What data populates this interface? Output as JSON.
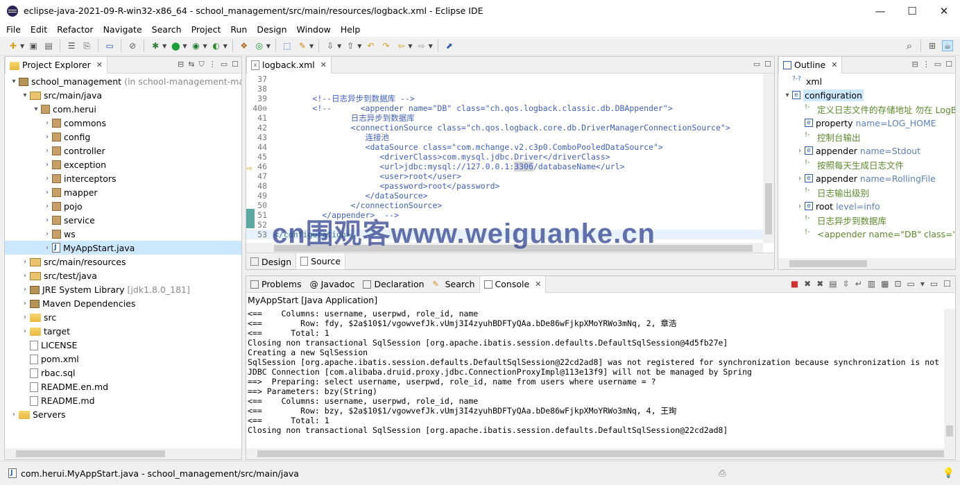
{
  "window": {
    "title": "eclipse-java-2021-09-R-win32-x86_64 - school_management/src/main/resources/logback.xml - Eclipse IDE",
    "minimize": "—",
    "maximize": "☐",
    "close": "✕"
  },
  "menu": [
    "File",
    "Edit",
    "Refactor",
    "Navigate",
    "Search",
    "Project",
    "Run",
    "Design",
    "Window",
    "Help"
  ],
  "explorer": {
    "tab": "Project Explorer",
    "rows": [
      {
        "label": "school_management",
        "suffix": "(in school-management-maste",
        "indent": 0,
        "arrow": "▾",
        "icon": "jar"
      },
      {
        "label": "src/main/java",
        "indent": 1,
        "arrow": "▾",
        "icon": "src"
      },
      {
        "label": "com.herui",
        "indent": 2,
        "arrow": "▾",
        "icon": "pkg"
      },
      {
        "label": "commons",
        "indent": 3,
        "arrow": "›",
        "icon": "pkg"
      },
      {
        "label": "config",
        "indent": 3,
        "arrow": "›",
        "icon": "pkg"
      },
      {
        "label": "controller",
        "indent": 3,
        "arrow": "›",
        "icon": "pkg"
      },
      {
        "label": "exception",
        "indent": 3,
        "arrow": "›",
        "icon": "pkg"
      },
      {
        "label": "interceptors",
        "indent": 3,
        "arrow": "›",
        "icon": "pkg"
      },
      {
        "label": "mapper",
        "indent": 3,
        "arrow": "›",
        "icon": "pkg"
      },
      {
        "label": "pojo",
        "indent": 3,
        "arrow": "›",
        "icon": "pkg"
      },
      {
        "label": "service",
        "indent": 3,
        "arrow": "›",
        "icon": "pkg"
      },
      {
        "label": "ws",
        "indent": 3,
        "arrow": "›",
        "icon": "pkg"
      },
      {
        "label": "MyAppStart.java",
        "indent": 3,
        "arrow": "›",
        "icon": "java",
        "selected": true
      },
      {
        "label": "src/main/resources",
        "indent": 1,
        "arrow": "›",
        "icon": "src"
      },
      {
        "label": "src/test/java",
        "indent": 1,
        "arrow": "›",
        "icon": "src"
      },
      {
        "label": "JRE System Library",
        "suffix": "[jdk1.8.0_181]",
        "indent": 1,
        "arrow": "›",
        "icon": "jar"
      },
      {
        "label": "Maven Dependencies",
        "indent": 1,
        "arrow": "›",
        "icon": "jar"
      },
      {
        "label": "src",
        "indent": 1,
        "arrow": "›",
        "icon": "folder"
      },
      {
        "label": "target",
        "indent": 1,
        "arrow": "›",
        "icon": "folder"
      },
      {
        "label": "LICENSE",
        "indent": 1,
        "arrow": "",
        "icon": "file"
      },
      {
        "label": "pom.xml",
        "indent": 1,
        "arrow": "",
        "icon": "file"
      },
      {
        "label": "rbac.sql",
        "indent": 1,
        "arrow": "",
        "icon": "file"
      },
      {
        "label": "README.en.md",
        "indent": 1,
        "arrow": "",
        "icon": "file"
      },
      {
        "label": "README.md",
        "indent": 1,
        "arrow": "",
        "icon": "file"
      },
      {
        "label": "Servers",
        "indent": 0,
        "arrow": "›",
        "icon": "folder"
      }
    ]
  },
  "editor": {
    "tab": "logback.xml",
    "lines": [
      {
        "n": "37",
        "h": ""
      },
      {
        "n": "38",
        "h": ""
      },
      {
        "n": "39",
        "h": "        <span class=\"c\">&lt;!--日志异步到数据库 --&gt;</span>"
      },
      {
        "n": "40⊖",
        "h": "        <span class=\"c\">&lt;!--      &lt;appender name=\"DB\" class=\"ch.qos.logback.classic.db.DBAppender\"&gt;</span>"
      },
      {
        "n": "41",
        "h": "                <span class=\"c\">日志异步到数据库</span>"
      },
      {
        "n": "42",
        "h": "                <span class=\"c\">&lt;connectionSource class=\"ch.qos.logback.core.db.DriverManagerConnectionSource\"&gt;</span>"
      },
      {
        "n": "43",
        "h": "                   <span class=\"c\">连接池</span>"
      },
      {
        "n": "44",
        "h": "                   <span class=\"c\">&lt;dataSource class=\"com.mchange.v2.c3p0.ComboPooledDataSource\"&gt;</span>"
      },
      {
        "n": "45",
        "h": "                      <span class=\"c\">&lt;driverClass&gt;com.mysql.jdbc.Driver&lt;/driverClass&gt;</span>"
      },
      {
        "n": "46",
        "h": "                      <span class=\"c\">&lt;url&gt;jdbc:mysql://127.0.0.1:<span style=\"background:#d4d4d4\">3306</span>/databaseName&lt;/url&gt;</span>"
      },
      {
        "n": "47",
        "h": "                      <span class=\"c\">&lt;user&gt;root&lt;/user&gt;</span>"
      },
      {
        "n": "48",
        "h": "                      <span class=\"c\">&lt;password&gt;root&lt;/password&gt;</span>"
      },
      {
        "n": "49",
        "h": "                   <span class=\"c\">&lt;/dataSource&gt;</span>"
      },
      {
        "n": "50",
        "h": "                <span class=\"c\">&lt;/connectionSource&gt;</span>"
      },
      {
        "n": "51",
        "h": "          <span class=\"c\">&lt;/appender&gt;  --&gt;</span>"
      },
      {
        "n": "52",
        "h": ""
      },
      {
        "n": "53",
        "h": "<span class=\"t\">&lt;/configuration&gt;</span>"
      }
    ],
    "bottom_tabs": [
      "Design",
      "Source"
    ]
  },
  "outline": {
    "tab": "Outline",
    "rows": [
      {
        "label": "xml",
        "indent": 0,
        "arrow": "",
        "kind": "pi"
      },
      {
        "label": "configuration",
        "indent": 0,
        "arrow": "▾",
        "kind": "el",
        "selected": true
      },
      {
        "label": "定义日志文件的存储地址 勿在 LogBa",
        "indent": 1,
        "arrow": "",
        "kind": "cm"
      },
      {
        "label": "property",
        "attr": "name=LOG_HOME",
        "indent": 1,
        "arrow": "",
        "kind": "el"
      },
      {
        "label": "控制台输出",
        "indent": 1,
        "arrow": "",
        "kind": "cm"
      },
      {
        "label": "appender",
        "attr": "name=Stdout",
        "indent": 1,
        "arrow": "›",
        "kind": "el"
      },
      {
        "label": "按照每天生成日志文件",
        "indent": 1,
        "arrow": "",
        "kind": "cm"
      },
      {
        "label": "appender",
        "attr": "name=RollingFile",
        "indent": 1,
        "arrow": "›",
        "kind": "el"
      },
      {
        "label": "日志输出级别",
        "indent": 1,
        "arrow": "",
        "kind": "cm"
      },
      {
        "label": "root",
        "attr": "level=info",
        "indent": 1,
        "arrow": "›",
        "kind": "el"
      },
      {
        "label": "日志异步到数据库",
        "indent": 1,
        "arrow": "",
        "kind": "cm"
      },
      {
        "label": "<appender name=\"DB\" class=\"ch",
        "indent": 1,
        "arrow": "",
        "kind": "cm"
      }
    ]
  },
  "bottom": {
    "tabs": [
      {
        "label": "Problems",
        "icon": "problems-icon"
      },
      {
        "label": "Javadoc",
        "icon": "javadoc-icon"
      },
      {
        "label": "Declaration",
        "icon": "declaration-icon"
      },
      {
        "label": "Search",
        "icon": "search-icon"
      },
      {
        "label": "Console",
        "icon": "console-icon",
        "active": true
      }
    ],
    "launch": "MyAppStart [Java Application]",
    "lines": [
      "<==    Columns: username, userpwd, role_id, name",
      "<==        Row: fdy, $2a$10$1/vgowvefJk.vUmj3I4zyuhBDFTyQAa.bDe86wFjkpXMoYRWo3mNq, 2, 章浩",
      "<==      Total: 1",
      "Closing non transactional SqlSession [org.apache.ibatis.session.defaults.DefaultSqlSession@4d5fb27e]",
      "Creating a new SqlSession",
      "SqlSession [org.apache.ibatis.session.defaults.DefaultSqlSession@22cd2ad8] was not registered for synchronization because synchronization is not",
      "JDBC Connection [com.alibaba.druid.proxy.jdbc.ConnectionProxyImpl@113e13f9] will not be managed by Spring",
      "==>  Preparing: select username, userpwd, role_id, name from users where username = ?",
      "==> Parameters: bzy(String)",
      "<==    Columns: username, userpwd, role_id, name",
      "<==        Row: bzy, $2a$10$1/vgowvefJk.vUmj3I4zyuhBDFTyQAa.bDe86wFjkpXMoYRWo3mNq, 4, 王珣",
      "<==      Total: 1",
      "Closing non transactional SqlSession [org.apache.ibatis.session.defaults.DefaultSqlSession@22cd2ad8]"
    ]
  },
  "status": {
    "text": "com.herui.MyAppStart.java - school_management/src/main/java"
  },
  "watermark": "cn围观客www.weiguanke.cn",
  "colors": {
    "comment": "#3f5fbf",
    "tag": "#3f7f7f",
    "selection": "#cce8ff"
  }
}
